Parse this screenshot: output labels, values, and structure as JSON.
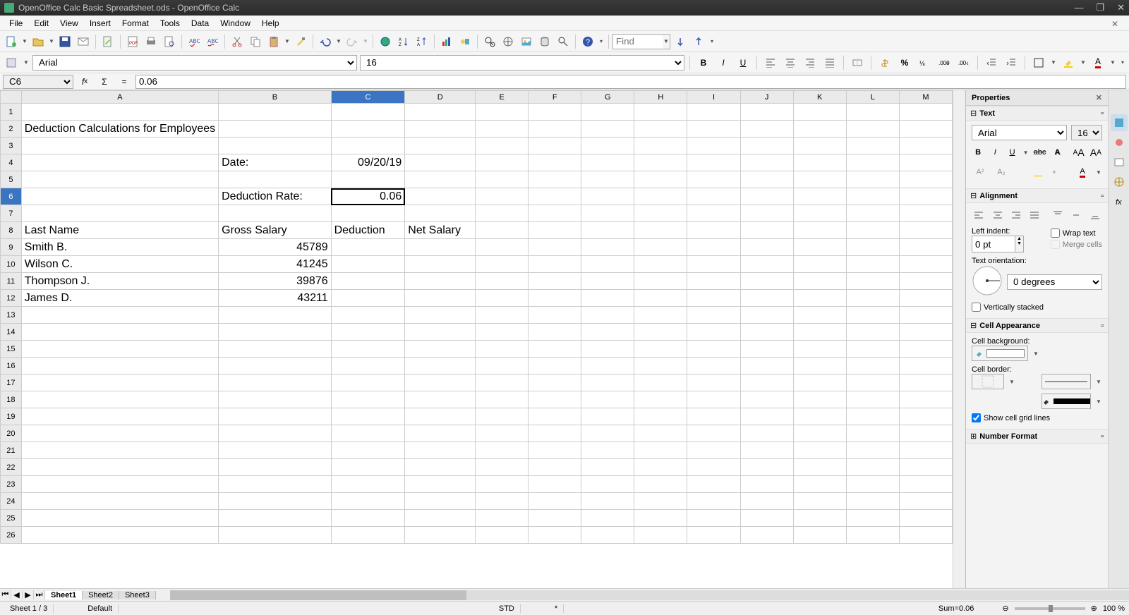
{
  "window": {
    "title": "OpenOffice Calc Basic Spreadsheet.ods - OpenOffice Calc"
  },
  "menu": [
    "File",
    "Edit",
    "View",
    "Insert",
    "Format",
    "Tools",
    "Data",
    "Window",
    "Help"
  ],
  "toolbar_find_placeholder": "Find",
  "format": {
    "font": "Arial",
    "size": "16"
  },
  "namebox": "C6",
  "formula": "0.06",
  "columns": [
    "A",
    "B",
    "C",
    "D",
    "E",
    "F",
    "G",
    "H",
    "I",
    "J",
    "K",
    "L",
    "M"
  ],
  "row_count": 26,
  "active_cell": {
    "row": 6,
    "col": "C"
  },
  "cells": {
    "A2": {
      "text": "Deduction Calculations for Employees",
      "align": "left"
    },
    "B4": {
      "text": "Date:",
      "align": "left"
    },
    "C4": {
      "text": "09/20/19",
      "align": "right"
    },
    "B6": {
      "text": "Deduction Rate:",
      "align": "left"
    },
    "C6": {
      "text": "0.06",
      "align": "right"
    },
    "A8": {
      "text": "Last Name",
      "align": "left"
    },
    "B8": {
      "text": "Gross Salary",
      "align": "left"
    },
    "C8": {
      "text": "Deduction",
      "align": "left"
    },
    "D8": {
      "text": "Net Salary",
      "align": "left"
    },
    "A9": {
      "text": "Smith B.",
      "align": "left"
    },
    "B9": {
      "text": "45789",
      "align": "right"
    },
    "A10": {
      "text": "Wilson C.",
      "align": "left"
    },
    "B10": {
      "text": "41245",
      "align": "right"
    },
    "A11": {
      "text": "Thompson J.",
      "align": "left"
    },
    "B11": {
      "text": "39876",
      "align": "right"
    },
    "A12": {
      "text": "James D.",
      "align": "left"
    },
    "B12": {
      "text": "43211",
      "align": "right"
    }
  },
  "col_widths": {
    "A": 120,
    "B": 160,
    "C": 105,
    "D": 100,
    "_default": 76
  },
  "sheets": [
    "Sheet1",
    "Sheet2",
    "Sheet3"
  ],
  "active_sheet": 0,
  "status": {
    "sheet": "Sheet 1 / 3",
    "style": "Default",
    "mode": "STD",
    "mod": "*",
    "sum": "Sum=0.06",
    "zoom": "100 %"
  },
  "sidebar": {
    "title": "Properties",
    "text_section": "Text",
    "align_section": "Alignment",
    "left_indent": "Left indent:",
    "left_indent_value": "0 pt",
    "wrap": "Wrap text",
    "merge": "Merge cells",
    "orientation_label": "Text orientation:",
    "orientation_value": "0 degrees",
    "vstack": "Vertically stacked",
    "appearance": "Cell Appearance",
    "bg_label": "Cell background:",
    "border_label": "Cell border:",
    "gridlines": "Show cell grid lines",
    "number_format": "Number Format",
    "font": "Arial",
    "size": "16"
  }
}
